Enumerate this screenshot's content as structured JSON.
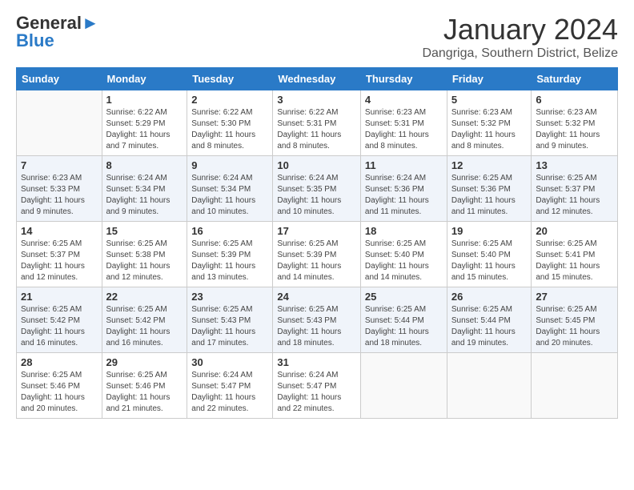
{
  "logo": {
    "general": "General",
    "blue": "Blue"
  },
  "title": {
    "month": "January 2024",
    "location": "Dangriga, Southern District, Belize"
  },
  "headers": [
    "Sunday",
    "Monday",
    "Tuesday",
    "Wednesday",
    "Thursday",
    "Friday",
    "Saturday"
  ],
  "weeks": [
    [
      {
        "day": "",
        "info": ""
      },
      {
        "day": "1",
        "info": "Sunrise: 6:22 AM\nSunset: 5:29 PM\nDaylight: 11 hours\nand 7 minutes."
      },
      {
        "day": "2",
        "info": "Sunrise: 6:22 AM\nSunset: 5:30 PM\nDaylight: 11 hours\nand 8 minutes."
      },
      {
        "day": "3",
        "info": "Sunrise: 6:22 AM\nSunset: 5:31 PM\nDaylight: 11 hours\nand 8 minutes."
      },
      {
        "day": "4",
        "info": "Sunrise: 6:23 AM\nSunset: 5:31 PM\nDaylight: 11 hours\nand 8 minutes."
      },
      {
        "day": "5",
        "info": "Sunrise: 6:23 AM\nSunset: 5:32 PM\nDaylight: 11 hours\nand 8 minutes."
      },
      {
        "day": "6",
        "info": "Sunrise: 6:23 AM\nSunset: 5:32 PM\nDaylight: 11 hours\nand 9 minutes."
      }
    ],
    [
      {
        "day": "7",
        "info": "Sunrise: 6:23 AM\nSunset: 5:33 PM\nDaylight: 11 hours\nand 9 minutes."
      },
      {
        "day": "8",
        "info": "Sunrise: 6:24 AM\nSunset: 5:34 PM\nDaylight: 11 hours\nand 9 minutes."
      },
      {
        "day": "9",
        "info": "Sunrise: 6:24 AM\nSunset: 5:34 PM\nDaylight: 11 hours\nand 10 minutes."
      },
      {
        "day": "10",
        "info": "Sunrise: 6:24 AM\nSunset: 5:35 PM\nDaylight: 11 hours\nand 10 minutes."
      },
      {
        "day": "11",
        "info": "Sunrise: 6:24 AM\nSunset: 5:36 PM\nDaylight: 11 hours\nand 11 minutes."
      },
      {
        "day": "12",
        "info": "Sunrise: 6:25 AM\nSunset: 5:36 PM\nDaylight: 11 hours\nand 11 minutes."
      },
      {
        "day": "13",
        "info": "Sunrise: 6:25 AM\nSunset: 5:37 PM\nDaylight: 11 hours\nand 12 minutes."
      }
    ],
    [
      {
        "day": "14",
        "info": "Sunrise: 6:25 AM\nSunset: 5:37 PM\nDaylight: 11 hours\nand 12 minutes."
      },
      {
        "day": "15",
        "info": "Sunrise: 6:25 AM\nSunset: 5:38 PM\nDaylight: 11 hours\nand 12 minutes."
      },
      {
        "day": "16",
        "info": "Sunrise: 6:25 AM\nSunset: 5:39 PM\nDaylight: 11 hours\nand 13 minutes."
      },
      {
        "day": "17",
        "info": "Sunrise: 6:25 AM\nSunset: 5:39 PM\nDaylight: 11 hours\nand 14 minutes."
      },
      {
        "day": "18",
        "info": "Sunrise: 6:25 AM\nSunset: 5:40 PM\nDaylight: 11 hours\nand 14 minutes."
      },
      {
        "day": "19",
        "info": "Sunrise: 6:25 AM\nSunset: 5:40 PM\nDaylight: 11 hours\nand 15 minutes."
      },
      {
        "day": "20",
        "info": "Sunrise: 6:25 AM\nSunset: 5:41 PM\nDaylight: 11 hours\nand 15 minutes."
      }
    ],
    [
      {
        "day": "21",
        "info": "Sunrise: 6:25 AM\nSunset: 5:42 PM\nDaylight: 11 hours\nand 16 minutes."
      },
      {
        "day": "22",
        "info": "Sunrise: 6:25 AM\nSunset: 5:42 PM\nDaylight: 11 hours\nand 16 minutes."
      },
      {
        "day": "23",
        "info": "Sunrise: 6:25 AM\nSunset: 5:43 PM\nDaylight: 11 hours\nand 17 minutes."
      },
      {
        "day": "24",
        "info": "Sunrise: 6:25 AM\nSunset: 5:43 PM\nDaylight: 11 hours\nand 18 minutes."
      },
      {
        "day": "25",
        "info": "Sunrise: 6:25 AM\nSunset: 5:44 PM\nDaylight: 11 hours\nand 18 minutes."
      },
      {
        "day": "26",
        "info": "Sunrise: 6:25 AM\nSunset: 5:44 PM\nDaylight: 11 hours\nand 19 minutes."
      },
      {
        "day": "27",
        "info": "Sunrise: 6:25 AM\nSunset: 5:45 PM\nDaylight: 11 hours\nand 20 minutes."
      }
    ],
    [
      {
        "day": "28",
        "info": "Sunrise: 6:25 AM\nSunset: 5:46 PM\nDaylight: 11 hours\nand 20 minutes."
      },
      {
        "day": "29",
        "info": "Sunrise: 6:25 AM\nSunset: 5:46 PM\nDaylight: 11 hours\nand 21 minutes."
      },
      {
        "day": "30",
        "info": "Sunrise: 6:24 AM\nSunset: 5:47 PM\nDaylight: 11 hours\nand 22 minutes."
      },
      {
        "day": "31",
        "info": "Sunrise: 6:24 AM\nSunset: 5:47 PM\nDaylight: 11 hours\nand 22 minutes."
      },
      {
        "day": "",
        "info": ""
      },
      {
        "day": "",
        "info": ""
      },
      {
        "day": "",
        "info": ""
      }
    ]
  ]
}
